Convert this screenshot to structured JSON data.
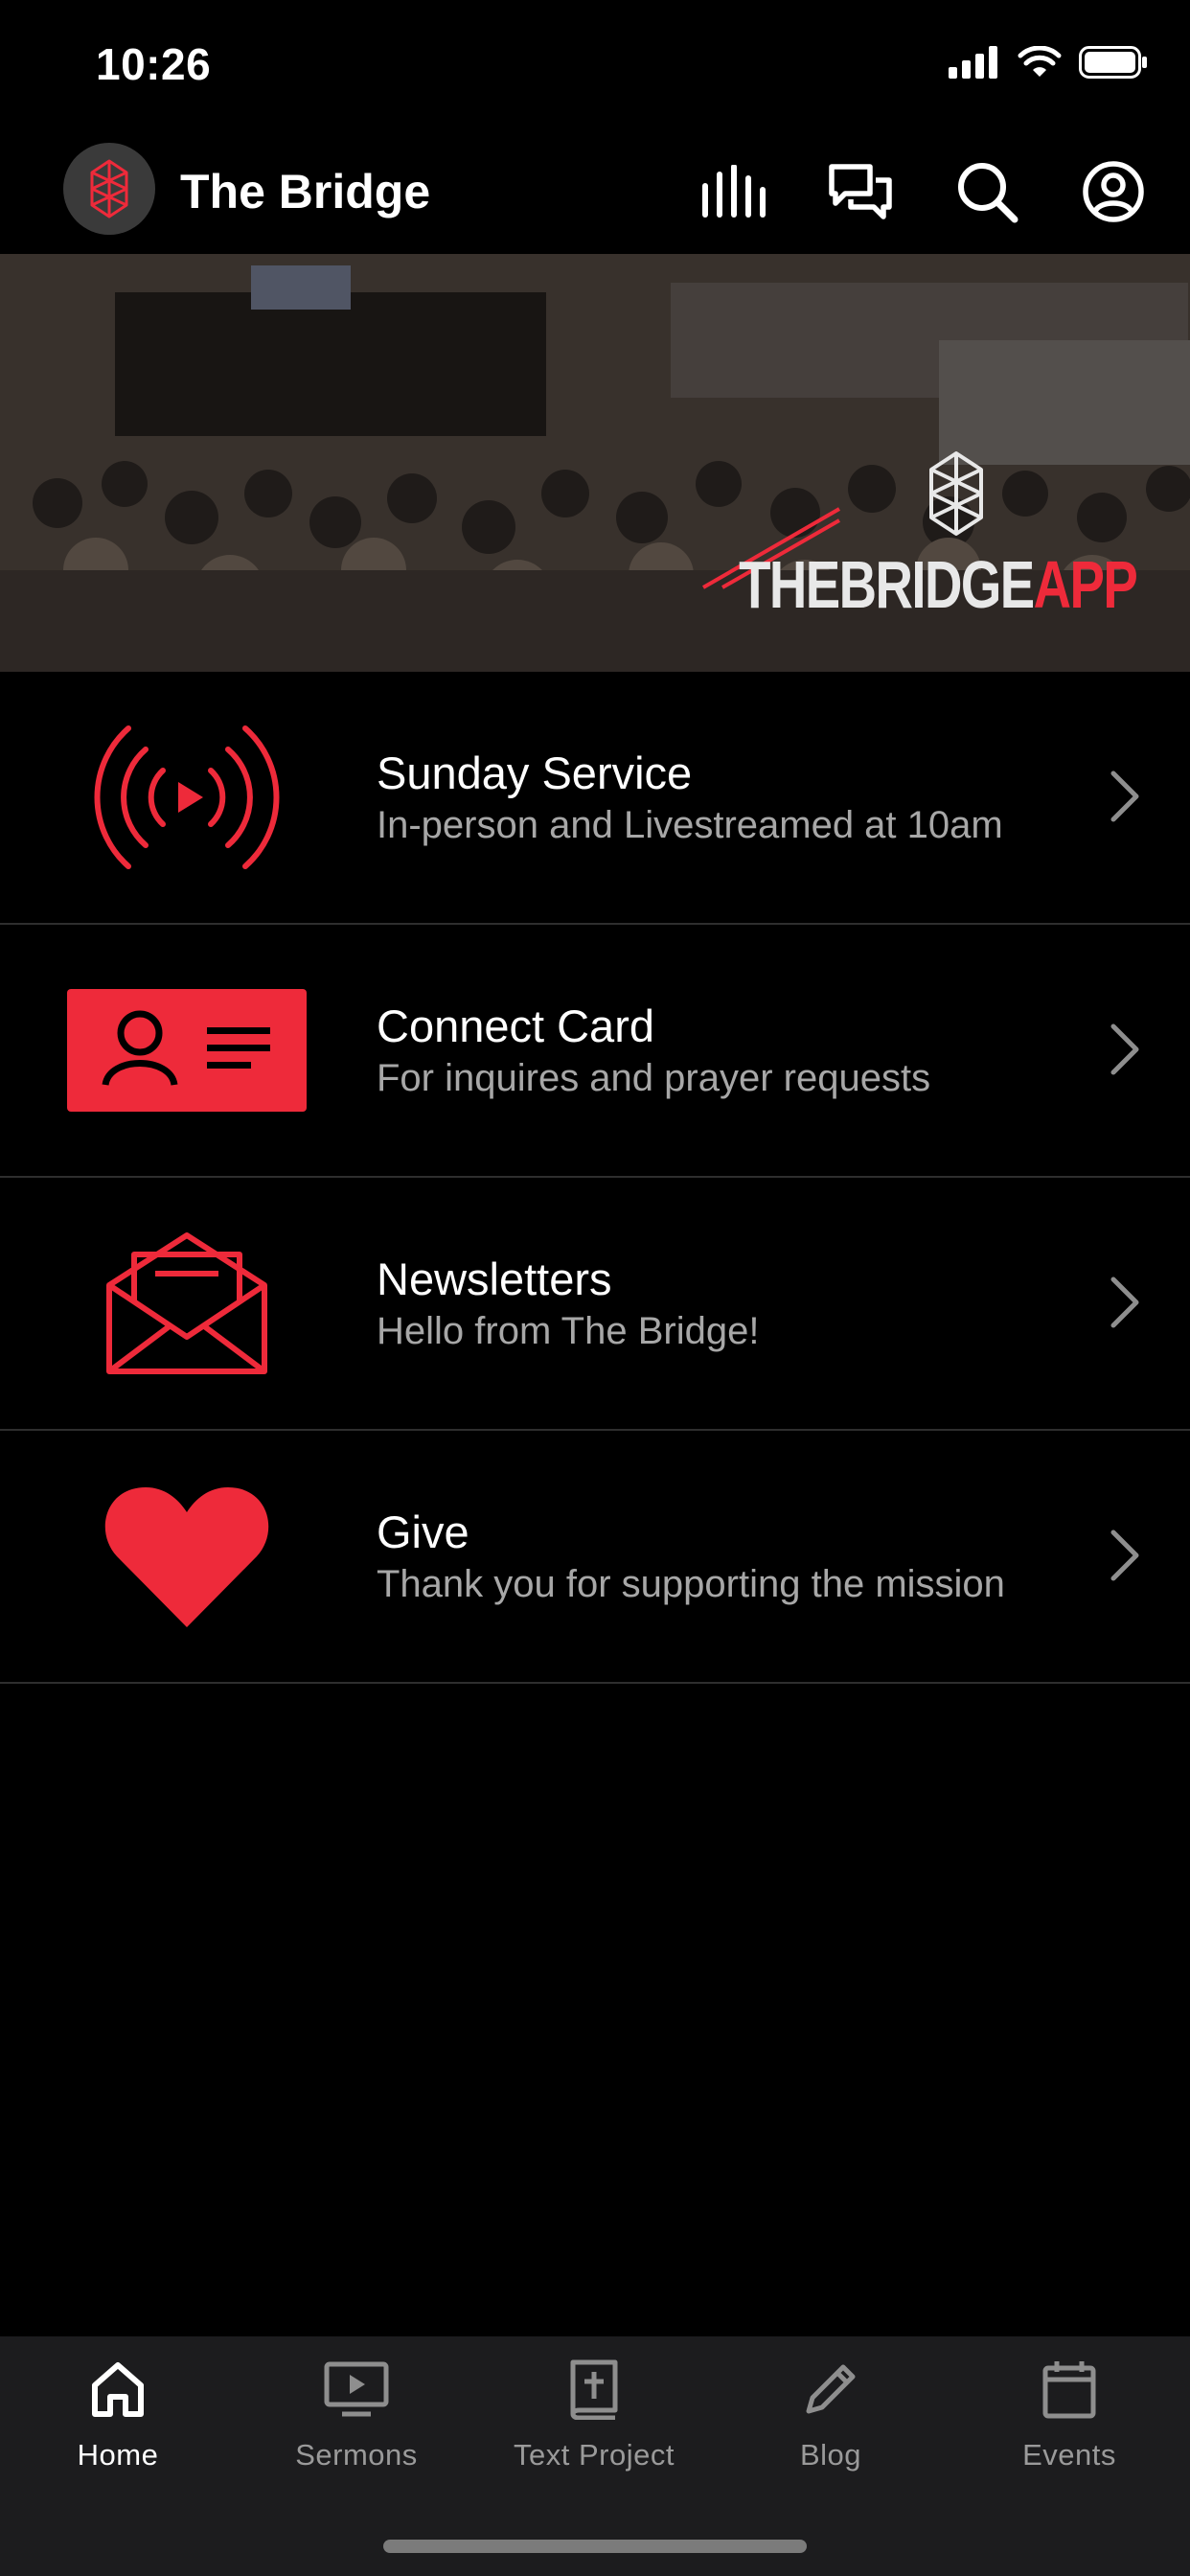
{
  "status_bar": {
    "time": "10:26"
  },
  "header": {
    "title": "The Bridge"
  },
  "banner": {
    "wordmark_white": "THEBRIDGE",
    "wordmark_red": "APP"
  },
  "menu": [
    {
      "title": "Sunday Service",
      "subtitle": "In-person and Livestreamed at 10am",
      "icon": "livestream-icon"
    },
    {
      "title": "Connect Card",
      "subtitle": "For inquires and prayer requests",
      "icon": "contact-card-icon"
    },
    {
      "title": "Newsletters",
      "subtitle": "Hello from The Bridge!",
      "icon": "envelope-icon"
    },
    {
      "title": "Give",
      "subtitle": "Thank you for supporting the mission",
      "icon": "heart-icon"
    }
  ],
  "tabs": [
    {
      "label": "Home",
      "icon": "home-icon",
      "active": true
    },
    {
      "label": "Sermons",
      "icon": "video-screen-icon",
      "active": false
    },
    {
      "label": "Text Project",
      "icon": "bible-icon",
      "active": false
    },
    {
      "label": "Blog",
      "icon": "pencil-icon",
      "active": false
    },
    {
      "label": "Events",
      "icon": "calendar-icon",
      "active": false
    }
  ],
  "colors": {
    "accent": "#ee2a3a",
    "background": "#000000",
    "tabbar": "#1c1c1e",
    "subtitle": "#a7a7a7"
  }
}
